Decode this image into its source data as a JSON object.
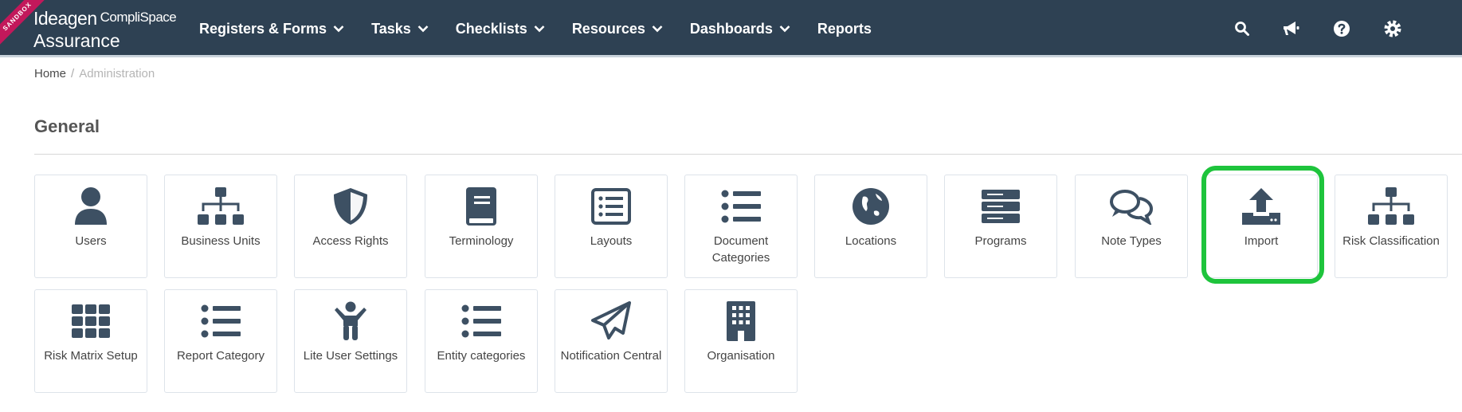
{
  "app": {
    "sandbox_label": "SANDBOX",
    "logo_line1": "Ideagen",
    "logo_product": "CompliSpace",
    "logo_line2": "Assurance"
  },
  "nav": {
    "items": [
      {
        "label": "Registers & Forms",
        "dropdown": true
      },
      {
        "label": "Tasks",
        "dropdown": true
      },
      {
        "label": "Checklists",
        "dropdown": true
      },
      {
        "label": "Resources",
        "dropdown": true
      },
      {
        "label": "Dashboards",
        "dropdown": true
      },
      {
        "label": "Reports",
        "dropdown": false
      }
    ],
    "right_icons": [
      "search-icon",
      "megaphone-icon",
      "help-icon",
      "settings-icon"
    ]
  },
  "breadcrumb": {
    "home": "Home",
    "separator": "/",
    "current": "Administration"
  },
  "section": {
    "title": "General"
  },
  "tiles": [
    {
      "label": "Users",
      "icon": "user-icon"
    },
    {
      "label": "Business Units",
      "icon": "sitemap-icon"
    },
    {
      "label": "Access Rights",
      "icon": "shield-icon"
    },
    {
      "label": "Terminology",
      "icon": "book-icon"
    },
    {
      "label": "Layouts",
      "icon": "layout-list-icon"
    },
    {
      "label": "Document Categories",
      "icon": "list-icon"
    },
    {
      "label": "Locations",
      "icon": "globe-icon"
    },
    {
      "label": "Programs",
      "icon": "server-icon"
    },
    {
      "label": "Note Types",
      "icon": "comments-icon"
    },
    {
      "label": "Import",
      "icon": "upload-icon",
      "highlighted": true
    },
    {
      "label": "Risk Classification",
      "icon": "sitemap-icon"
    },
    {
      "label": "Risk Matrix Setup",
      "icon": "grid-icon"
    },
    {
      "label": "Report Category",
      "icon": "list-icon"
    },
    {
      "label": "Lite User Settings",
      "icon": "child-icon"
    },
    {
      "label": "Entity categories",
      "icon": "list-icon"
    },
    {
      "label": "Notification Central",
      "icon": "paper-plane-icon"
    },
    {
      "label": "Organisation",
      "icon": "building-icon"
    }
  ],
  "colors": {
    "topbar": "#2e4153",
    "icon": "#3d5063",
    "highlight": "#1ec43c",
    "sandbox": "#c2185b"
  }
}
